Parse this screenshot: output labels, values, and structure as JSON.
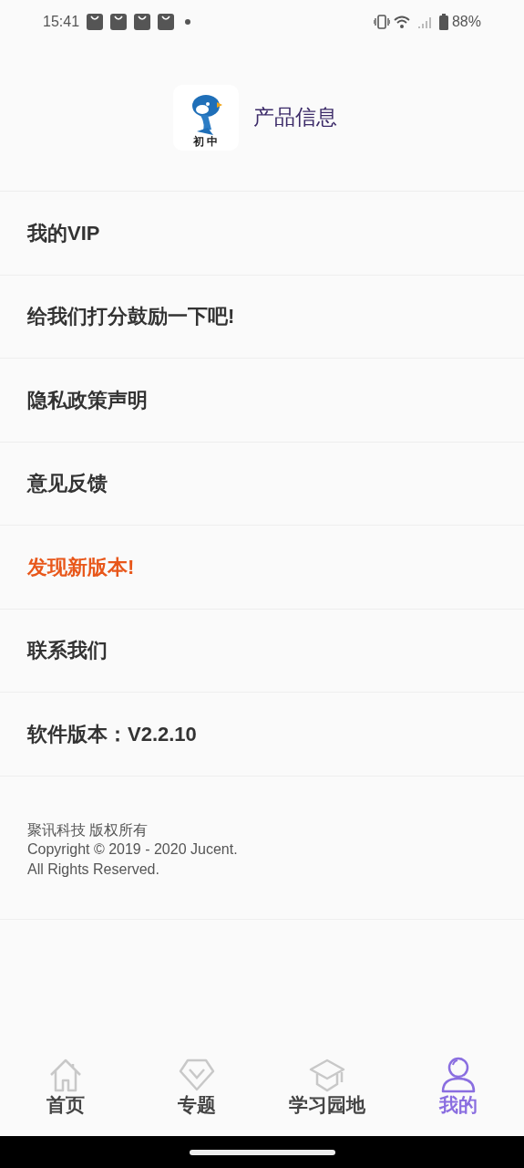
{
  "status_bar": {
    "time": "15:41",
    "battery": "88%"
  },
  "header": {
    "logo_label": "初 中",
    "title": "产品信息"
  },
  "menu": [
    {
      "label": "我的VIP",
      "kind": "normal"
    },
    {
      "label": "给我们打分鼓励一下吧!",
      "kind": "normal"
    },
    {
      "label": "隐私政策声明",
      "kind": "normal"
    },
    {
      "label": "意见反馈",
      "kind": "normal"
    },
    {
      "label": "发现新版本!",
      "kind": "highlight"
    },
    {
      "label": "联系我们",
      "kind": "normal"
    },
    {
      "label": "软件版本：V2.2.10",
      "kind": "normal"
    }
  ],
  "footer": {
    "company": "聚讯科技 版权所有",
    "copyright": "Copyright © 2019 - 2020 Jucent.",
    "rights": "All Rights Reserved."
  },
  "tabs": [
    {
      "label": "首页",
      "selected": false
    },
    {
      "label": "专题",
      "selected": false
    },
    {
      "label": "学习园地",
      "selected": false
    },
    {
      "label": "我的",
      "selected": true
    }
  ]
}
